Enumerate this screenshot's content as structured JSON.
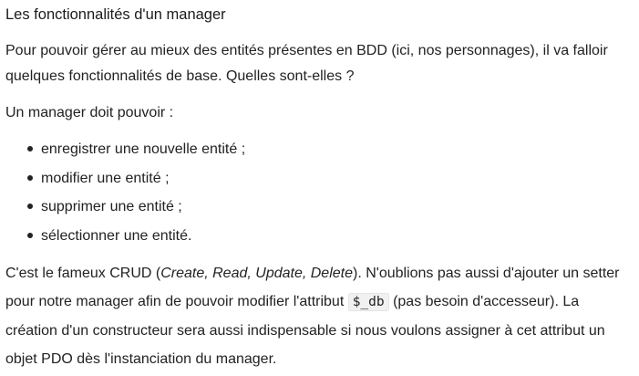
{
  "section": {
    "heading": "Les fonctionnalités d'un manager",
    "intro": "Pour pouvoir gérer au mieux des entités présentes en BDD (ici, nos personnages), il va falloir quelques fonctionnalités de base. Quelles sont-elles ?",
    "lead": "Un manager doit pouvoir :",
    "list": [
      "enregistrer une nouvelle entité ;",
      "modifier une entité ;",
      "supprimer une entité ;",
      "sélectionner une entité."
    ],
    "closing": {
      "part1": "C'est le fameux CRUD (",
      "crud_terms": "Create, Read, Update, Delete",
      "part2": "). N'oublions pas aussi d'ajouter un setter pour notre manager afin de pouvoir modifier l'attribut ",
      "code": "$_db",
      "part3": " (pas besoin d'accesseur). La création d'un constructeur sera aussi indispensable si nous voulons assigner à cet attribut un objet PDO dès l'instanciation du manager."
    }
  }
}
